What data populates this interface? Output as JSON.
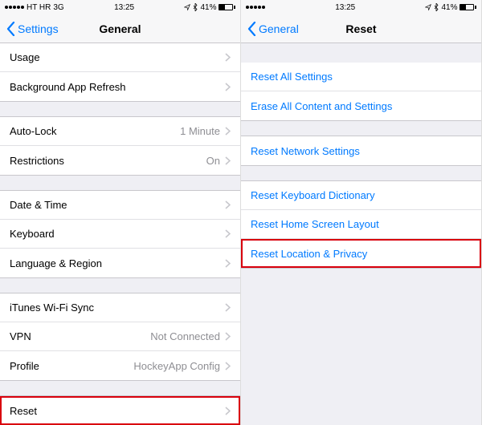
{
  "status": {
    "carrier": "HT HR",
    "network": "3G",
    "time": "13:25",
    "battery_pct": "41%"
  },
  "left": {
    "back_label": "Settings",
    "title": "General",
    "rows": {
      "usage": "Usage",
      "bar": "Background App Refresh",
      "autolock": "Auto-Lock",
      "autolock_val": "1 Minute",
      "restrictions": "Restrictions",
      "restrictions_val": "On",
      "datetime": "Date & Time",
      "keyboard": "Keyboard",
      "langregion": "Language & Region",
      "itunes": "iTunes Wi-Fi Sync",
      "vpn": "VPN",
      "vpn_val": "Not Connected",
      "profile": "Profile",
      "profile_val": "HockeyApp Config",
      "reset": "Reset"
    }
  },
  "right": {
    "back_label": "General",
    "title": "Reset",
    "rows": {
      "resetall": "Reset All Settings",
      "erase": "Erase All Content and Settings",
      "network": "Reset Network Settings",
      "keyboard": "Reset Keyboard Dictionary",
      "home": "Reset Home Screen Layout",
      "locpriv": "Reset Location & Privacy"
    }
  }
}
